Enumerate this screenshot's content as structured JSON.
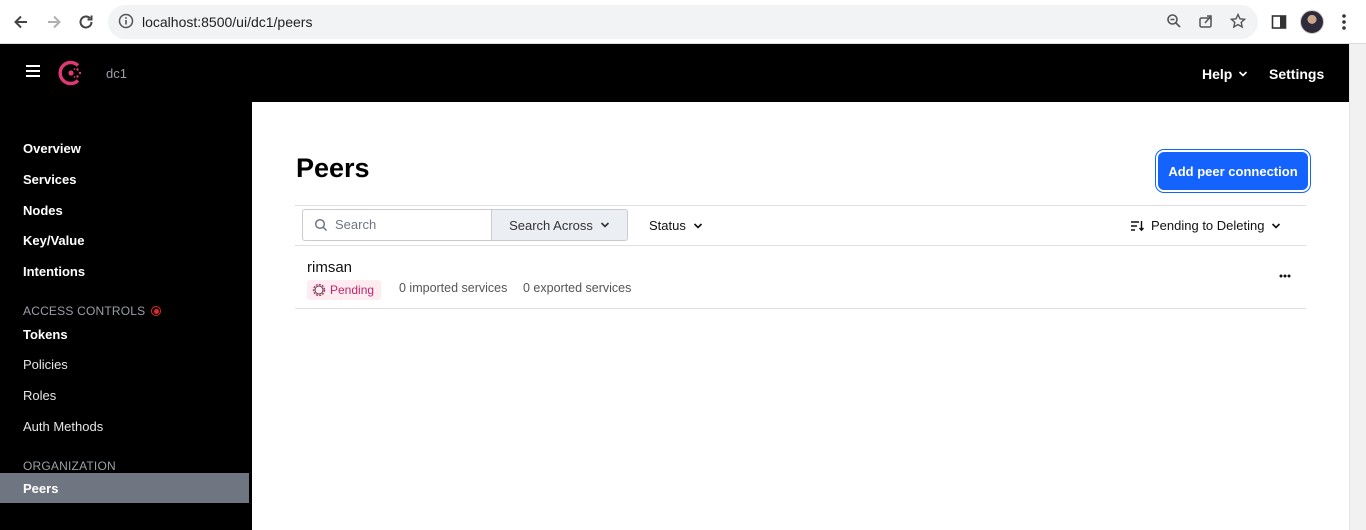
{
  "browser": {
    "url": "localhost:8500/ui/dc1/peers"
  },
  "header": {
    "datacenter": "dc1",
    "help_label": "Help",
    "settings_label": "Settings"
  },
  "sidebar": {
    "items": [
      {
        "label": "Overview"
      },
      {
        "label": "Services"
      },
      {
        "label": "Nodes"
      },
      {
        "label": "Key/Value"
      },
      {
        "label": "Intentions"
      }
    ],
    "access_controls_label": "ACCESS CONTROLS",
    "access_items": [
      {
        "label": "Tokens"
      },
      {
        "label": "Policies"
      },
      {
        "label": "Roles"
      },
      {
        "label": "Auth Methods"
      }
    ],
    "organization_label": "ORGANIZATION",
    "active_item": "Peers"
  },
  "main": {
    "title": "Peers",
    "add_button": "Add peer connection",
    "search_placeholder": "Search",
    "search_across": "Search Across",
    "status_filter": "Status",
    "sort_label": "Pending to Deleting",
    "peers": [
      {
        "name": "rimsan",
        "status": "Pending",
        "imported": "0 imported services",
        "exported": "0 exported services"
      }
    ]
  },
  "colors": {
    "accent": "#1563ff",
    "consul_brand": "#e03875",
    "pending_badge_bg": "#ffecf1",
    "pending_badge_text": "#c0256b"
  }
}
